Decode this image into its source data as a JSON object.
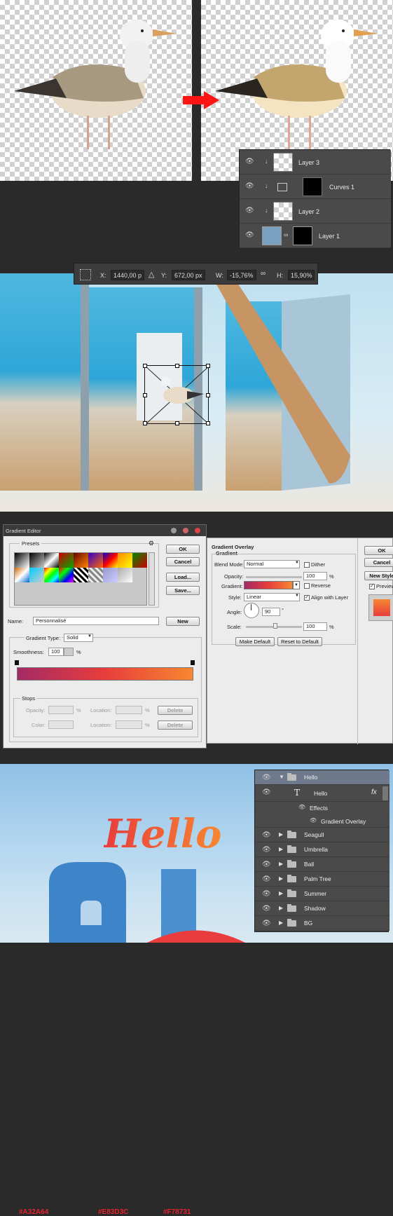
{
  "layers_top": [
    {
      "name": "Layer 3",
      "type": "image"
    },
    {
      "name": "Curves 1",
      "type": "adjustment"
    },
    {
      "name": "Layer 2",
      "type": "image"
    },
    {
      "name": "Layer 1",
      "type": "image"
    }
  ],
  "transform_bar": {
    "x_label": "X:",
    "x_value": "1440,00 p",
    "y_label": "Y:",
    "y_value": "672,00 px",
    "w_label": "W:",
    "w_value": "-15,76%",
    "h_label": "H:",
    "h_value": "15,90%"
  },
  "gradient_editor": {
    "title": "Gradient Editor",
    "presets_label": "Presets",
    "ok": "OK",
    "cancel": "Cancel",
    "load": "Load...",
    "save": "Save...",
    "name_label": "Name:",
    "name_value": "Personnalisé",
    "new_label": "New",
    "type_label": "Gradient Type:",
    "type_value": "Solid",
    "smooth_label": "Smoothness:",
    "smooth_value": "100",
    "pct": "%",
    "stops": [
      {
        "hex": "#A32A64",
        "color": "#a32a64"
      },
      {
        "hex": "#E83D3C",
        "color": "#e83d3c"
      },
      {
        "hex": "#F78731",
        "color": "#f78731"
      }
    ],
    "stops_label": "Stops",
    "opacity_label": "Opacity:",
    "color_label": "Color:",
    "location_label": "Location:",
    "delete_label": "Delete"
  },
  "overlay": {
    "title": "Gradient Overlay",
    "section": "Gradient",
    "blend_label": "Blend Mode:",
    "blend_value": "Normal",
    "dither": "Dither",
    "opacity_label": "Opacity:",
    "opacity_value": "100",
    "pct": "%",
    "gradient_label": "Gradient:",
    "reverse": "Reverse",
    "style_label": "Style:",
    "style_value": "Linear",
    "align": "Align with Layer",
    "angle_label": "Angle:",
    "angle_value": "90",
    "deg": "°",
    "scale_label": "Scale:",
    "scale_value": "100",
    "make_default": "Make Default",
    "reset_default": "Reset to Default",
    "ok": "OK",
    "cancel": "Cancel",
    "new_style": "New Style",
    "preview": "Preview"
  },
  "hello_text": "Hello",
  "layers_bottom": {
    "group": "Hello",
    "text_layer": "Hello",
    "fx": "fx",
    "effects": "Effects",
    "gradient_overlay": "Gradient Overlay",
    "groups": [
      "Seagull",
      "Umbrella",
      "Ball",
      "Palm Tree",
      "Summer",
      "Shadow",
      "BG"
    ]
  },
  "colors": {
    "arrow": "#ff1414",
    "panel": "#4a4a4a",
    "dialog": "#ececec",
    "accent": "#e8232f"
  }
}
